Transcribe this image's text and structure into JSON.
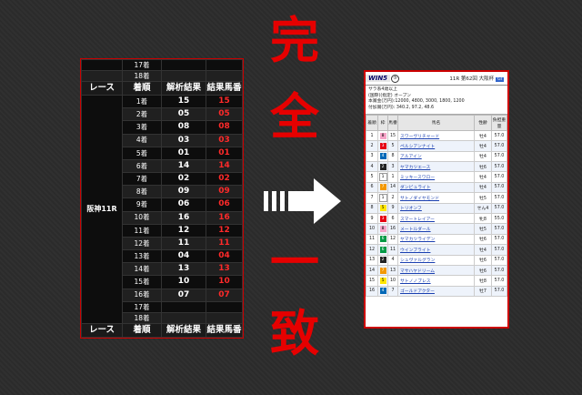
{
  "left_table": {
    "top_rows": [
      "17着",
      "18着"
    ],
    "headers": {
      "race": "レース",
      "order": "着順",
      "analysis": "解析結果",
      "result": "結果馬番"
    },
    "race_name": "阪神11R",
    "rows": [
      {
        "order": "1着",
        "analysis": "15",
        "result": "15"
      },
      {
        "order": "2着",
        "analysis": "05",
        "result": "05"
      },
      {
        "order": "3着",
        "analysis": "08",
        "result": "08"
      },
      {
        "order": "4着",
        "analysis": "03",
        "result": "03"
      },
      {
        "order": "5着",
        "analysis": "01",
        "result": "01"
      },
      {
        "order": "6着",
        "analysis": "14",
        "result": "14"
      },
      {
        "order": "7着",
        "analysis": "02",
        "result": "02"
      },
      {
        "order": "8着",
        "analysis": "09",
        "result": "09"
      },
      {
        "order": "9着",
        "analysis": "06",
        "result": "06"
      },
      {
        "order": "10着",
        "analysis": "16",
        "result": "16"
      },
      {
        "order": "11着",
        "analysis": "12",
        "result": "12"
      },
      {
        "order": "12着",
        "analysis": "11",
        "result": "11"
      },
      {
        "order": "13着",
        "analysis": "04",
        "result": "04"
      },
      {
        "order": "14着",
        "analysis": "13",
        "result": "13"
      },
      {
        "order": "15着",
        "analysis": "10",
        "result": "10"
      },
      {
        "order": "16着",
        "analysis": "07",
        "result": "07"
      },
      {
        "order": "17着",
        "analysis": "",
        "result": ""
      },
      {
        "order": "18着",
        "analysis": "",
        "result": ""
      }
    ]
  },
  "center": {
    "kanji_top": [
      "完",
      "全"
    ],
    "kanji_bottom": [
      "一",
      "致"
    ],
    "accent": "#e60000"
  },
  "card": {
    "logo": "WIN5",
    "race_num": "⑤",
    "race_title": "11R 第62回 大阪杯",
    "badge": "GI",
    "info_lines": [
      "サラ系4歳以上",
      "(国際)(指定) オープン",
      "本賞金(万円):12000, 4800, 3000, 1800, 1200",
      "付加賞(万円): 340.2, 97.2, 48.6"
    ],
    "headers": [
      "着順",
      "枠",
      "馬番",
      "馬名",
      "性齢",
      "負担重量"
    ],
    "rows": [
      {
        "pos": "1",
        "waku": "8",
        "num": "15",
        "name": "スワーヴリチャード",
        "sex": "牡4",
        "wt": "57.0"
      },
      {
        "pos": "2",
        "waku": "3",
        "num": "5",
        "name": "ペルシアンナイト",
        "sex": "牡4",
        "wt": "57.0"
      },
      {
        "pos": "3",
        "waku": "4",
        "num": "8",
        "name": "アルアイン",
        "sex": "牡4",
        "wt": "57.0"
      },
      {
        "pos": "4",
        "waku": "2",
        "num": "3",
        "name": "ヤマカツエース",
        "sex": "牡6",
        "wt": "57.0"
      },
      {
        "pos": "5",
        "waku": "1",
        "num": "1",
        "name": "ミッキースワロー",
        "sex": "牡4",
        "wt": "57.0"
      },
      {
        "pos": "6",
        "waku": "7",
        "num": "14",
        "name": "ダンビュライト",
        "sex": "牡4",
        "wt": "57.0"
      },
      {
        "pos": "7",
        "waku": "1",
        "num": "2",
        "name": "サトノダイヤモンド",
        "sex": "牡5",
        "wt": "57.0"
      },
      {
        "pos": "8",
        "waku": "5",
        "num": "9",
        "name": "トリオンフ",
        "sex": "せん4",
        "wt": "57.0"
      },
      {
        "pos": "9",
        "waku": "3",
        "num": "6",
        "name": "スマートレイアー",
        "sex": "牝8",
        "wt": "55.0"
      },
      {
        "pos": "10",
        "waku": "8",
        "num": "16",
        "name": "メートルダール",
        "sex": "牡5",
        "wt": "57.0"
      },
      {
        "pos": "11",
        "waku": "6",
        "num": "12",
        "name": "ヤマカツライデン",
        "sex": "牡6",
        "wt": "57.0"
      },
      {
        "pos": "12",
        "waku": "6",
        "num": "11",
        "name": "ウインブライト",
        "sex": "牡4",
        "wt": "57.0"
      },
      {
        "pos": "13",
        "waku": "2",
        "num": "4",
        "name": "シュヴァルグラン",
        "sex": "牡6",
        "wt": "57.0"
      },
      {
        "pos": "14",
        "waku": "7",
        "num": "13",
        "name": "マサハヤドリーム",
        "sex": "牡6",
        "wt": "57.0"
      },
      {
        "pos": "15",
        "waku": "5",
        "num": "10",
        "name": "サトノノブレス",
        "sex": "牡8",
        "wt": "57.0"
      },
      {
        "pos": "16",
        "waku": "4",
        "num": "7",
        "name": "ゴールドアクター",
        "sex": "牡7",
        "wt": "57.0"
      }
    ],
    "waku_colors": {
      "1": [
        "#ffffff",
        "#000000"
      ],
      "2": [
        "#222222",
        "#ffffff"
      ],
      "3": [
        "#e60012",
        "#ffffff"
      ],
      "4": [
        "#0068b7",
        "#ffffff"
      ],
      "5": [
        "#ffe600",
        "#000000"
      ],
      "6": [
        "#009944",
        "#ffffff"
      ],
      "7": [
        "#f39800",
        "#ffffff"
      ],
      "8": [
        "#f5a3c7",
        "#000000"
      ]
    }
  }
}
